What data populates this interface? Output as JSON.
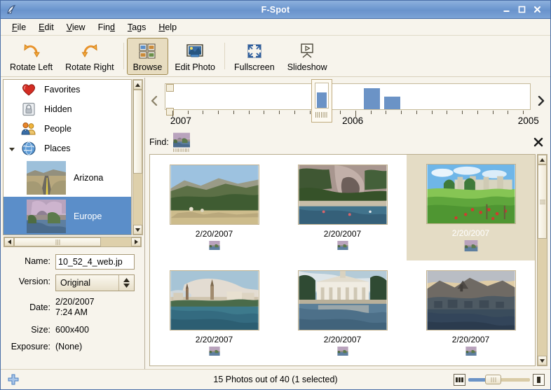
{
  "window": {
    "title": "F-Spot",
    "app_icon": "fspot-icon",
    "controls": {
      "minimize": "minimize-icon",
      "maximize": "maximize-icon",
      "close": "close-icon"
    }
  },
  "menubar": {
    "items": [
      {
        "label": "File",
        "mnemonic": "F"
      },
      {
        "label": "Edit",
        "mnemonic": "E"
      },
      {
        "label": "View",
        "mnemonic": "V"
      },
      {
        "label": "Find",
        "mnemonic": "d"
      },
      {
        "label": "Tags",
        "mnemonic": "T"
      },
      {
        "label": "Help",
        "mnemonic": "H"
      }
    ]
  },
  "toolbar": {
    "buttons": [
      {
        "label": "Rotate Left",
        "icon": "rotate-left-icon",
        "active": false
      },
      {
        "label": "Rotate Right",
        "icon": "rotate-right-icon",
        "active": false
      },
      {
        "label": "Browse",
        "icon": "browse-icon",
        "active": true
      },
      {
        "label": "Edit Photo",
        "icon": "edit-photo-icon",
        "active": false
      },
      {
        "label": "Fullscreen",
        "icon": "fullscreen-icon",
        "active": false
      },
      {
        "label": "Slideshow",
        "icon": "slideshow-icon",
        "active": false
      }
    ]
  },
  "sidebar": {
    "tags": [
      {
        "label": "Favorites",
        "icon": "heart-icon",
        "kind": "icon",
        "selected": false,
        "expander": false
      },
      {
        "label": "Hidden",
        "icon": "lock-icon",
        "kind": "icon",
        "selected": false,
        "expander": false
      },
      {
        "label": "People",
        "icon": "people-icon",
        "kind": "icon",
        "selected": false,
        "expander": false
      },
      {
        "label": "Places",
        "icon": "globe-icon",
        "kind": "icon",
        "selected": false,
        "expander": true
      },
      {
        "label": "Arizona",
        "icon": "arizona-thumb",
        "kind": "thumb",
        "selected": false,
        "expander": false
      },
      {
        "label": "Europe",
        "icon": "europe-thumb",
        "kind": "thumb",
        "selected": true,
        "expander": false
      }
    ]
  },
  "metadata": {
    "name_label": "Name:",
    "name_value": "10_52_4_web.jp",
    "version_label": "Version:",
    "version_value": "Original",
    "date_label": "Date:",
    "date_value_line1": "2/20/2007",
    "date_value_line2": "7:24 AM",
    "size_label": "Size:",
    "size_value": "600x400",
    "exposure_label": "Exposure:",
    "exposure_value": "(None)",
    "add_tag_icon": "plus-icon"
  },
  "timeline": {
    "prev_icon": "chevron-left-icon",
    "next_icon": "chevron-right-icon",
    "cursor_position_pct": 41.5,
    "years": [
      {
        "label": "2007",
        "pos_pct": 1.5
      },
      {
        "label": "2006",
        "pos_pct": 48.5
      },
      {
        "label": "2005",
        "pos_pct": 96.5
      }
    ],
    "chart_data": {
      "type": "bar",
      "title": "",
      "xlabel": "",
      "ylabel": "",
      "categories": [
        "2007-01",
        "2007-02",
        "2007-03",
        "2007-04",
        "2007-05",
        "2007-06",
        "2007-07",
        "2007-08",
        "2007-09",
        "2007-10",
        "2007-11",
        "2007-12",
        "2006-01",
        "2006-02",
        "2006-03",
        "2006-04",
        "2006-05",
        "2006-06",
        "2006-07",
        "2006-08",
        "2006-09",
        "2006-10",
        "2006-11",
        "2006-12"
      ],
      "values": [
        0,
        0,
        0,
        0,
        0,
        0,
        0,
        0,
        0,
        0,
        0,
        15,
        0,
        0,
        25,
        15,
        0,
        0,
        0,
        0,
        0,
        0,
        0,
        0
      ],
      "ylim": [
        0,
        30
      ],
      "grid": false
    }
  },
  "find": {
    "label": "Find:",
    "chip_icon": "europe-thumb",
    "close_icon": "close-x-icon"
  },
  "grid": {
    "photos": [
      {
        "date": "2/20/2007",
        "tag_icon": "europe-thumb",
        "selected": false,
        "scene": "green-hills"
      },
      {
        "date": "2/20/2007",
        "tag_icon": "europe-thumb",
        "selected": false,
        "scene": "stone-arch-river"
      },
      {
        "date": "2/20/2007",
        "tag_icon": "europe-thumb",
        "selected": true,
        "scene": "vineyard-castle"
      },
      {
        "date": "2/20/2007",
        "tag_icon": "europe-thumb",
        "selected": false,
        "scene": "riverside-town"
      },
      {
        "date": "2/20/2007",
        "tag_icon": "europe-thumb",
        "selected": false,
        "scene": "palace-reflection"
      },
      {
        "date": "2/20/2007",
        "tag_icon": "europe-thumb",
        "selected": false,
        "scene": "fortress-dusk"
      }
    ]
  },
  "statusbar": {
    "add_icon": "plus-icon",
    "text": "15 Photos out of 40 (1 selected)",
    "zoom_small_icon": "small-thumbs-icon",
    "zoom_large_icon": "large-thumb-icon",
    "zoom_value_pct": 28
  },
  "colors": {
    "title_blue": "#6f99d0",
    "selection_blue": "#5b8ec9",
    "panel_bg": "#f7f4ec",
    "cell_selected": "#e4dcc5",
    "histogram_bar": "#6b93c6",
    "border": "#b9ad8e"
  }
}
